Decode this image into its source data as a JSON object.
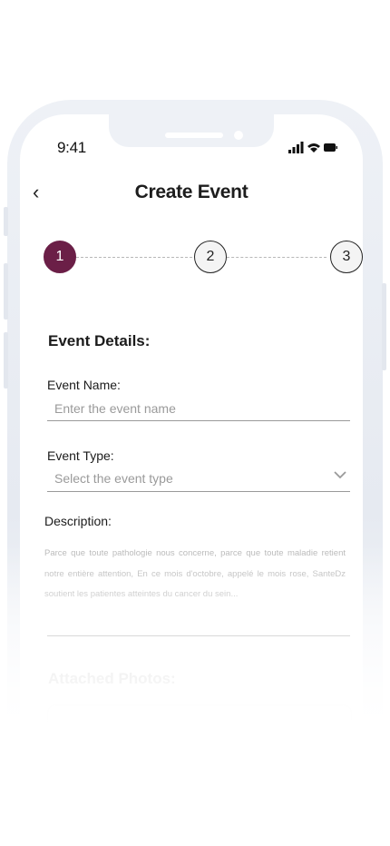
{
  "status_bar": {
    "time": "9:41"
  },
  "header": {
    "title": "Create Event"
  },
  "stepper": {
    "steps": [
      "1",
      "2",
      "3"
    ],
    "active_step": 1
  },
  "form": {
    "section_title": "Event Details:",
    "event_name": {
      "label": "Event Name:",
      "placeholder": "Enter the event name"
    },
    "event_type": {
      "label": "Event Type:",
      "placeholder": "Select the event type"
    },
    "description": {
      "label": "Description:",
      "text": "Parce que toute pathologie nous concerne, parce que toute maladie retient notre entière attention, En ce mois d'octobre, appelé le mois rose, SanteDz soutient les patientes atteintes du cancer du sein..."
    },
    "attached_photos_title": "Attached Photos:"
  },
  "colors": {
    "accent": "#6b1f47"
  }
}
